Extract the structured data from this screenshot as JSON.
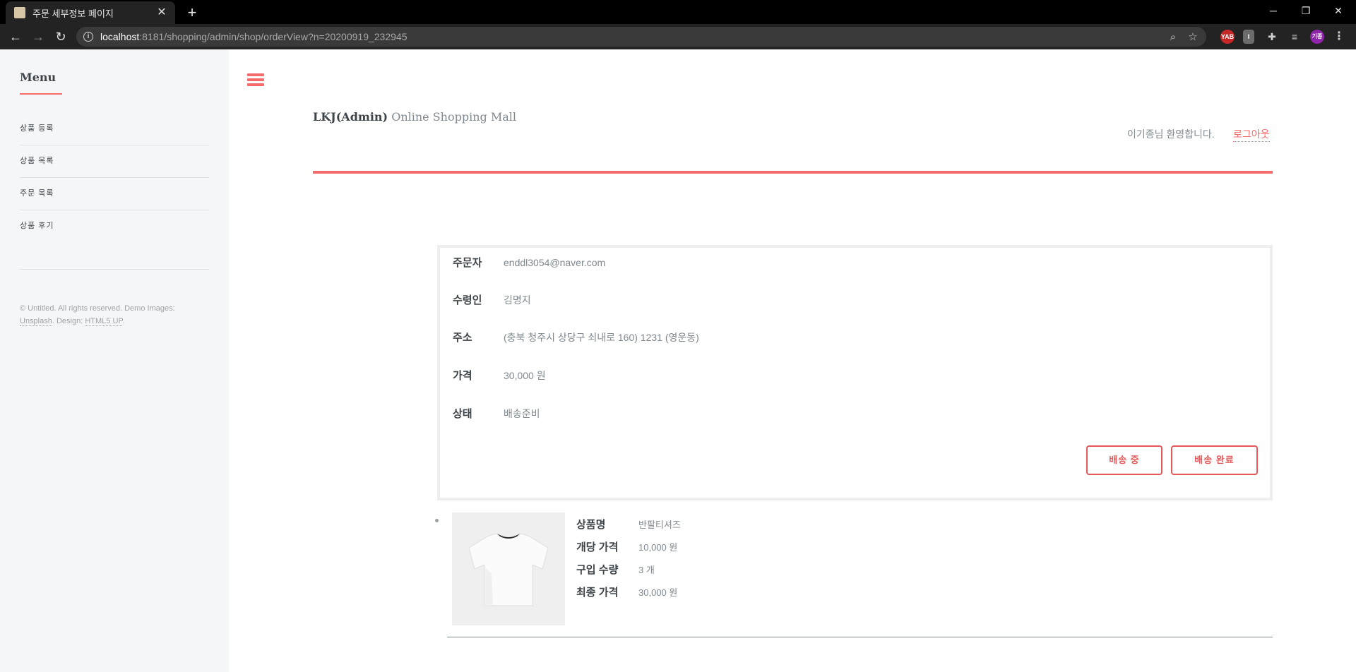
{
  "browser": {
    "tab_title": "주문 세부정보 페이지",
    "url_host": "localhost",
    "url_rest": ":8181/shopping/admin/shop/orderView?n=20200919_232945",
    "profile_initials": "기종",
    "ext_yab": "YAB"
  },
  "sidebar": {
    "title": "Menu",
    "items": [
      {
        "label": "상품 등록"
      },
      {
        "label": "상품 목록"
      },
      {
        "label": "주문 목록"
      },
      {
        "label": "상품 후기"
      }
    ],
    "footer_prefix": "© Untitled. All rights reserved. Demo Images: ",
    "footer_link1": "Unsplash",
    "footer_mid": ". Design: ",
    "footer_link2": "HTML5 UP",
    "footer_suffix": "."
  },
  "header": {
    "brand_bold": "LKJ(Admin)",
    "brand_rest": " Online Shopping Mall",
    "welcome": "이기종님 환영합니다.",
    "logout": "로그아웃"
  },
  "order": {
    "orderer_label": "주문자",
    "orderer": "enddl3054@naver.com",
    "recipient_label": "수령인",
    "recipient": "김명지",
    "address_label": "주소",
    "address": "(충북 청주시 상당구 쇠내로 160) 1231 (영운동)",
    "price_label": "가격",
    "price": "30,000 원",
    "status_label": "상태",
    "status": "배송준비",
    "btn_shipping": "배송 중",
    "btn_delivered": "배송 완료"
  },
  "product": {
    "name_label": "상품명",
    "name": "반팔티셔즈",
    "unit_label": "개당 가격",
    "unit_price": "10,000 원",
    "qty_label": "구입 수량",
    "qty": "3 개",
    "total_label": "최종 가격",
    "total": "30,000 원"
  },
  "colors": {
    "accent": "#f56a6a",
    "text_dark": "#3d4449",
    "text_muted": "#7f888f",
    "sidebar_bg": "#f5f6f7"
  }
}
